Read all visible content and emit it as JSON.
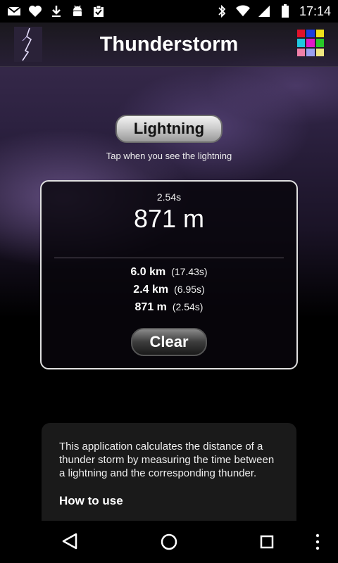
{
  "statusbar": {
    "time": "17:14",
    "left_icons": [
      "gmail-icon",
      "heart-icon",
      "download-icon",
      "android-icon",
      "clipboard-icon"
    ],
    "right_icons": [
      "bluetooth-icon",
      "wifi-icon",
      "signal-icon",
      "battery-icon"
    ]
  },
  "appbar": {
    "title": "Thunderstorm"
  },
  "main": {
    "lightning_label": "Lightning",
    "hint": "Tap when you see the lightning",
    "current_time": "2.54s",
    "current_distance": "871 m",
    "history": [
      {
        "distance": "6.0 km",
        "time": "(17.43s)"
      },
      {
        "distance": "2.4 km",
        "time": "(6.95s)"
      },
      {
        "distance": "871 m",
        "time": "(2.54s)"
      }
    ],
    "clear_label": "Clear"
  },
  "info": {
    "text": "This application calculates the distance of a thunder storm by measuring the time between a lightning and the corresponding thunder.",
    "heading": "How to use"
  },
  "colors": {
    "grid": [
      "#e0122b",
      "#1a3de0",
      "#f0e21a",
      "#1ec8e0",
      "#e018c8",
      "#28c828",
      "#f080a8",
      "#9aa0f0",
      "#f0e880"
    ]
  }
}
